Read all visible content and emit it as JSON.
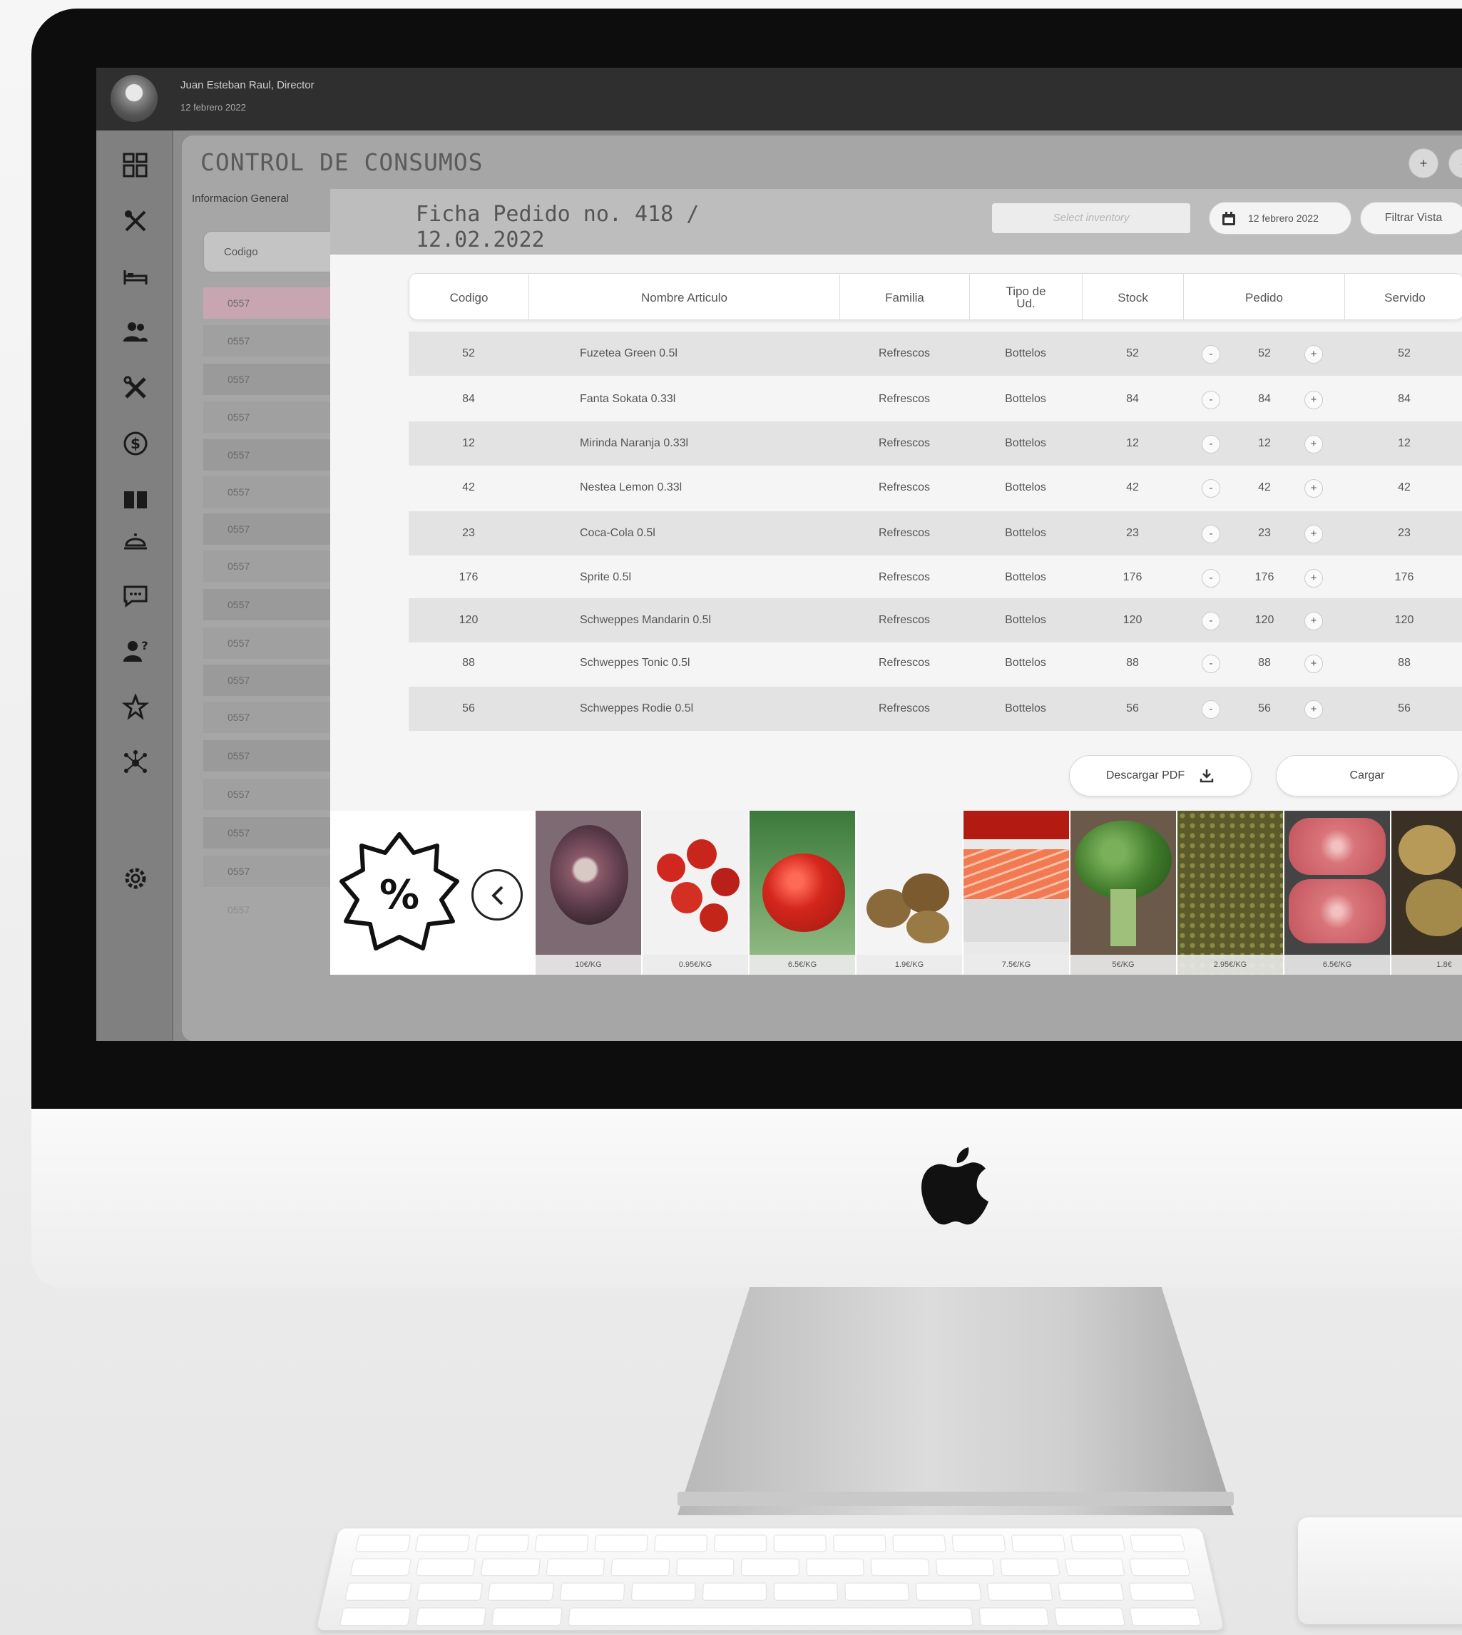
{
  "user": {
    "name": "Juan Esteban Raul, Director",
    "date": "12 febrero 2022"
  },
  "page_title": "CONTROL DE CONSUMOS",
  "header_buttons": [
    "+",
    "-"
  ],
  "left_panel": {
    "title": "Informacion General",
    "column": "Codigo",
    "rows": [
      "0557",
      "0557",
      "0557",
      "0557",
      "0557",
      "0557",
      "0557",
      "0557",
      "0557",
      "0557",
      "0557",
      "0557",
      "0557",
      "0557",
      "0557",
      "0557",
      "0557"
    ]
  },
  "order": {
    "title": "Ficha Pedido no. 418 /",
    "date": "12.02.2022",
    "select_placeholder": "Select inventory",
    "date_filter": "12 febrero 2022",
    "filter_button": "Filtrar Vista"
  },
  "table": {
    "headers": {
      "codigo": "Codigo",
      "nombre": "Nombre Articulo",
      "familia": "Familia",
      "tipo": "Tipo de Ud.",
      "stock": "Stock",
      "pedido": "Pedido",
      "servido": "Servido"
    },
    "rows": [
      {
        "codigo": "52",
        "nombre": "Fuzetea Green 0.5l",
        "familia": "Refrescos",
        "tipo": "Bottelos",
        "stock": "52",
        "pedido": "52",
        "servido": "52"
      },
      {
        "codigo": "84",
        "nombre": "Fanta Sokata 0.33l",
        "familia": "Refrescos",
        "tipo": "Bottelos",
        "stock": "84",
        "pedido": "84",
        "servido": "84"
      },
      {
        "codigo": "12",
        "nombre": "Mirinda Naranja 0.33l",
        "familia": "Refrescos",
        "tipo": "Bottelos",
        "stock": "12",
        "pedido": "12",
        "servido": "12"
      },
      {
        "codigo": "42",
        "nombre": "Nestea Lemon 0.33l",
        "familia": "Refrescos",
        "tipo": "Bottelos",
        "stock": "42",
        "pedido": "42",
        "servido": "42"
      },
      {
        "codigo": "23",
        "nombre": "Coca-Cola 0.5l",
        "familia": "Refrescos",
        "tipo": "Bottelos",
        "stock": "23",
        "pedido": "23",
        "servido": "23"
      },
      {
        "codigo": "176",
        "nombre": "Sprite 0.5l",
        "familia": "Refrescos",
        "tipo": "Bottelos",
        "stock": "176",
        "pedido": "176",
        "servido": "176"
      },
      {
        "codigo": "120",
        "nombre": "Schweppes Mandarin 0.5l",
        "familia": "Refrescos",
        "tipo": "Bottelos",
        "stock": "120",
        "pedido": "120",
        "servido": "120"
      },
      {
        "codigo": "88",
        "nombre": "Schweppes Tonic 0.5l",
        "familia": "Refrescos",
        "tipo": "Bottelos",
        "stock": "88",
        "pedido": "88",
        "servido": "88"
      },
      {
        "codigo": "56",
        "nombre": "Schweppes Rodie 0.5l",
        "familia": "Refrescos",
        "tipo": "Bottelos",
        "stock": "56",
        "pedido": "56",
        "servido": "56"
      }
    ],
    "minus": "-",
    "plus": "+"
  },
  "actions": {
    "download_pdf": "Descargar PDF",
    "load": "Cargar"
  },
  "promo": {
    "symbol": "%"
  },
  "products": [
    {
      "item": "octopus",
      "price": "10€/KG",
      "color": "#6b4a55"
    },
    {
      "item": "cherry-tomatoes",
      "price": "0.95€/KG",
      "color": "#c8261c"
    },
    {
      "item": "tomato",
      "price": "6.5€/KG",
      "color": "#d4261c"
    },
    {
      "item": "kiwi",
      "price": "1.9€/KG",
      "color": "#8a6a3a"
    },
    {
      "item": "salmon",
      "price": "7.5€/KG",
      "color": "#f0704a"
    },
    {
      "item": "broccoli",
      "price": "5€/KG",
      "color": "#3f7a2a"
    },
    {
      "item": "lentils",
      "price": "2.95€/KG",
      "color": "#7c7a3a"
    },
    {
      "item": "beef",
      "price": "6.5€/KG",
      "color": "#d9757a"
    },
    {
      "item": "potatoes",
      "price": "1.8€",
      "color": "#a48a4a"
    }
  ]
}
